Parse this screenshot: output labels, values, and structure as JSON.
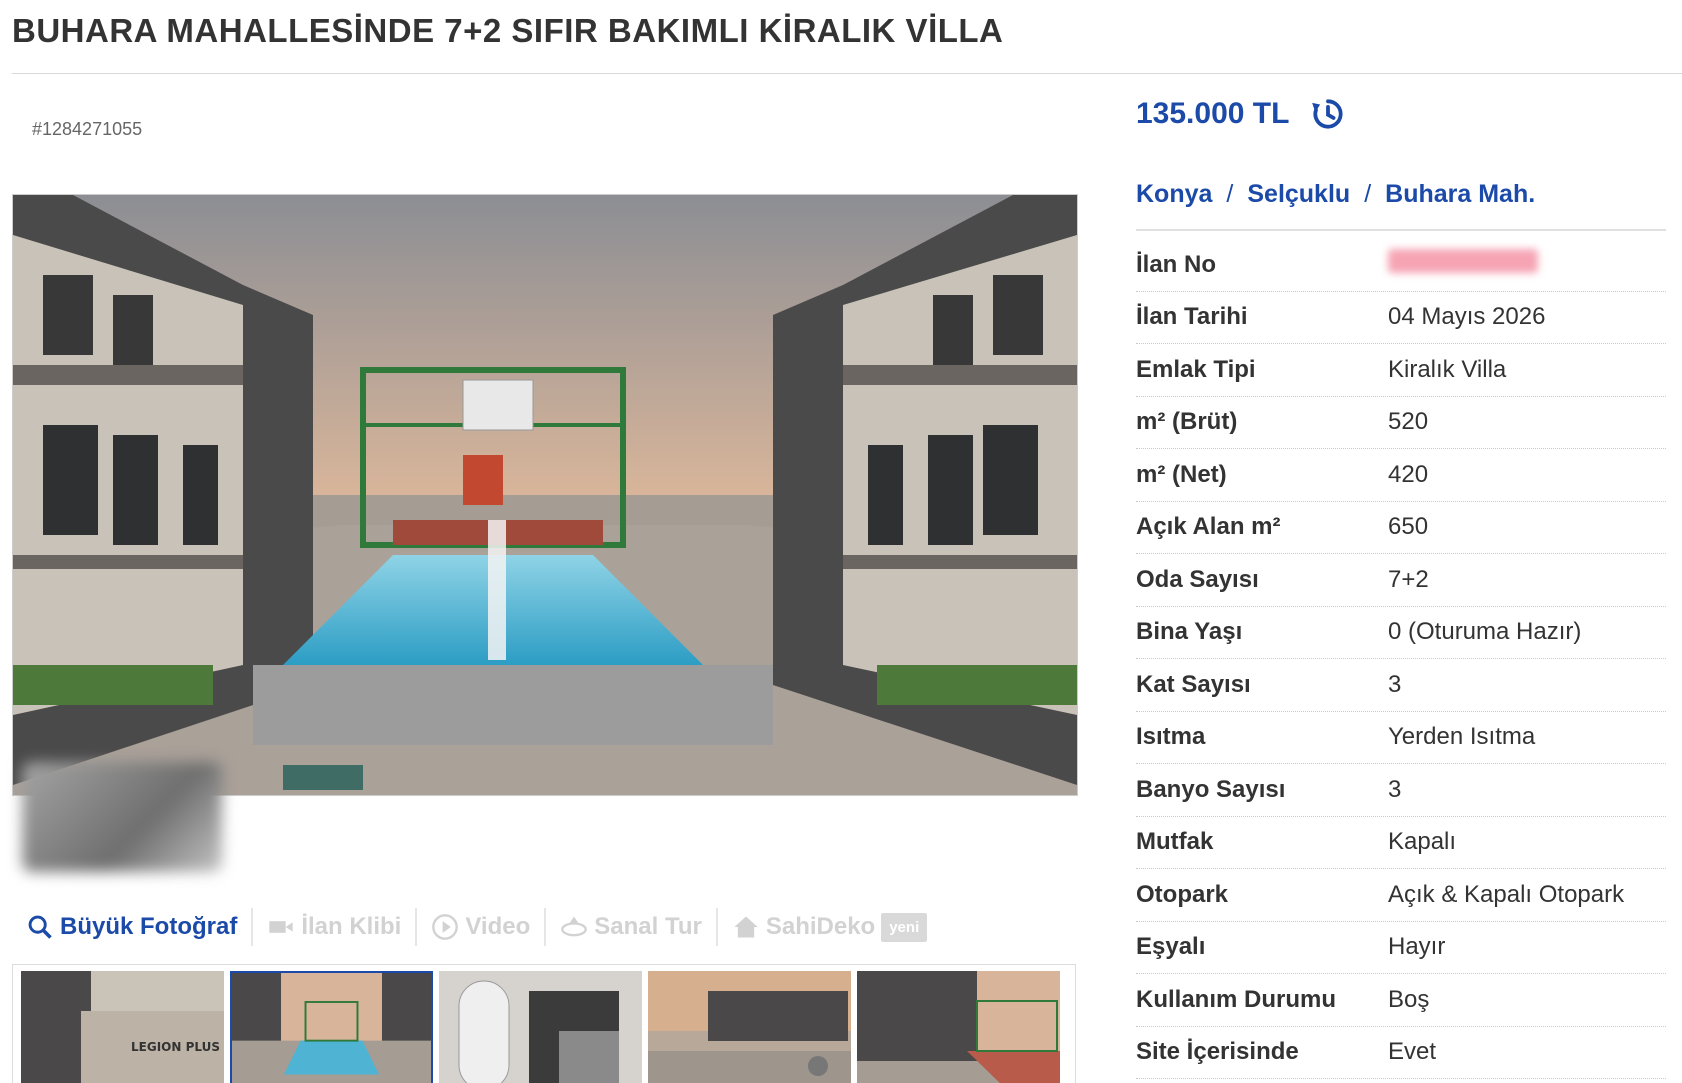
{
  "page_title": "BUHARA MAHALLESİNDE 7+2 SIFIR BAKIMLI KİRALIK VİLLA",
  "listing_code": "#1284271055",
  "price": "135.000 TL",
  "breadcrumb": [
    "Konya",
    "Selçuklu",
    "Buhara Mah."
  ],
  "breadcrumb_separator": "/",
  "toolbar": {
    "large_photo": "Büyük Fotoğraf",
    "ilan_klibi": "İlan Klibi",
    "video": "Video",
    "sanal_tur": "Sanal Tur",
    "sahideko": "SahiDeko",
    "new_badge": "yeni"
  },
  "specs": [
    {
      "label": "İlan No",
      "value": ""
    },
    {
      "label": "İlan Tarihi",
      "value": "04 Mayıs 2026"
    },
    {
      "label": "Emlak Tipi",
      "value": "Kiralık Villa"
    },
    {
      "label": "m² (Brüt)",
      "value": "520"
    },
    {
      "label": "m² (Net)",
      "value": "420"
    },
    {
      "label": "Açık Alan m²",
      "value": "650"
    },
    {
      "label": "Oda Sayısı",
      "value": "7+2"
    },
    {
      "label": "Bina Yaşı",
      "value": "0 (Oturuma Hazır)"
    },
    {
      "label": "Kat Sayısı",
      "value": "3"
    },
    {
      "label": "Isıtma",
      "value": "Yerden Isıtma"
    },
    {
      "label": "Banyo Sayısı",
      "value": "3"
    },
    {
      "label": "Mutfak",
      "value": "Kapalı"
    },
    {
      "label": "Otopark",
      "value": "Açık & Kapalı Otopark"
    },
    {
      "label": "Eşyalı",
      "value": "Hayır"
    },
    {
      "label": "Kullanım Durumu",
      "value": "Boş"
    },
    {
      "label": "Site İçerisinde",
      "value": "Evet"
    }
  ],
  "thumbnail_text": "LEGION PLUS VILLAGE",
  "icons": {
    "search": "search-icon",
    "camera": "video-camera-icon",
    "play": "play-icon",
    "tour": "virtual-tour-icon",
    "house": "house-icon",
    "history": "price-history-icon"
  },
  "colors": {
    "accent": "#1b4aa8",
    "disabled": "#d2d2d2",
    "text": "#333333"
  }
}
